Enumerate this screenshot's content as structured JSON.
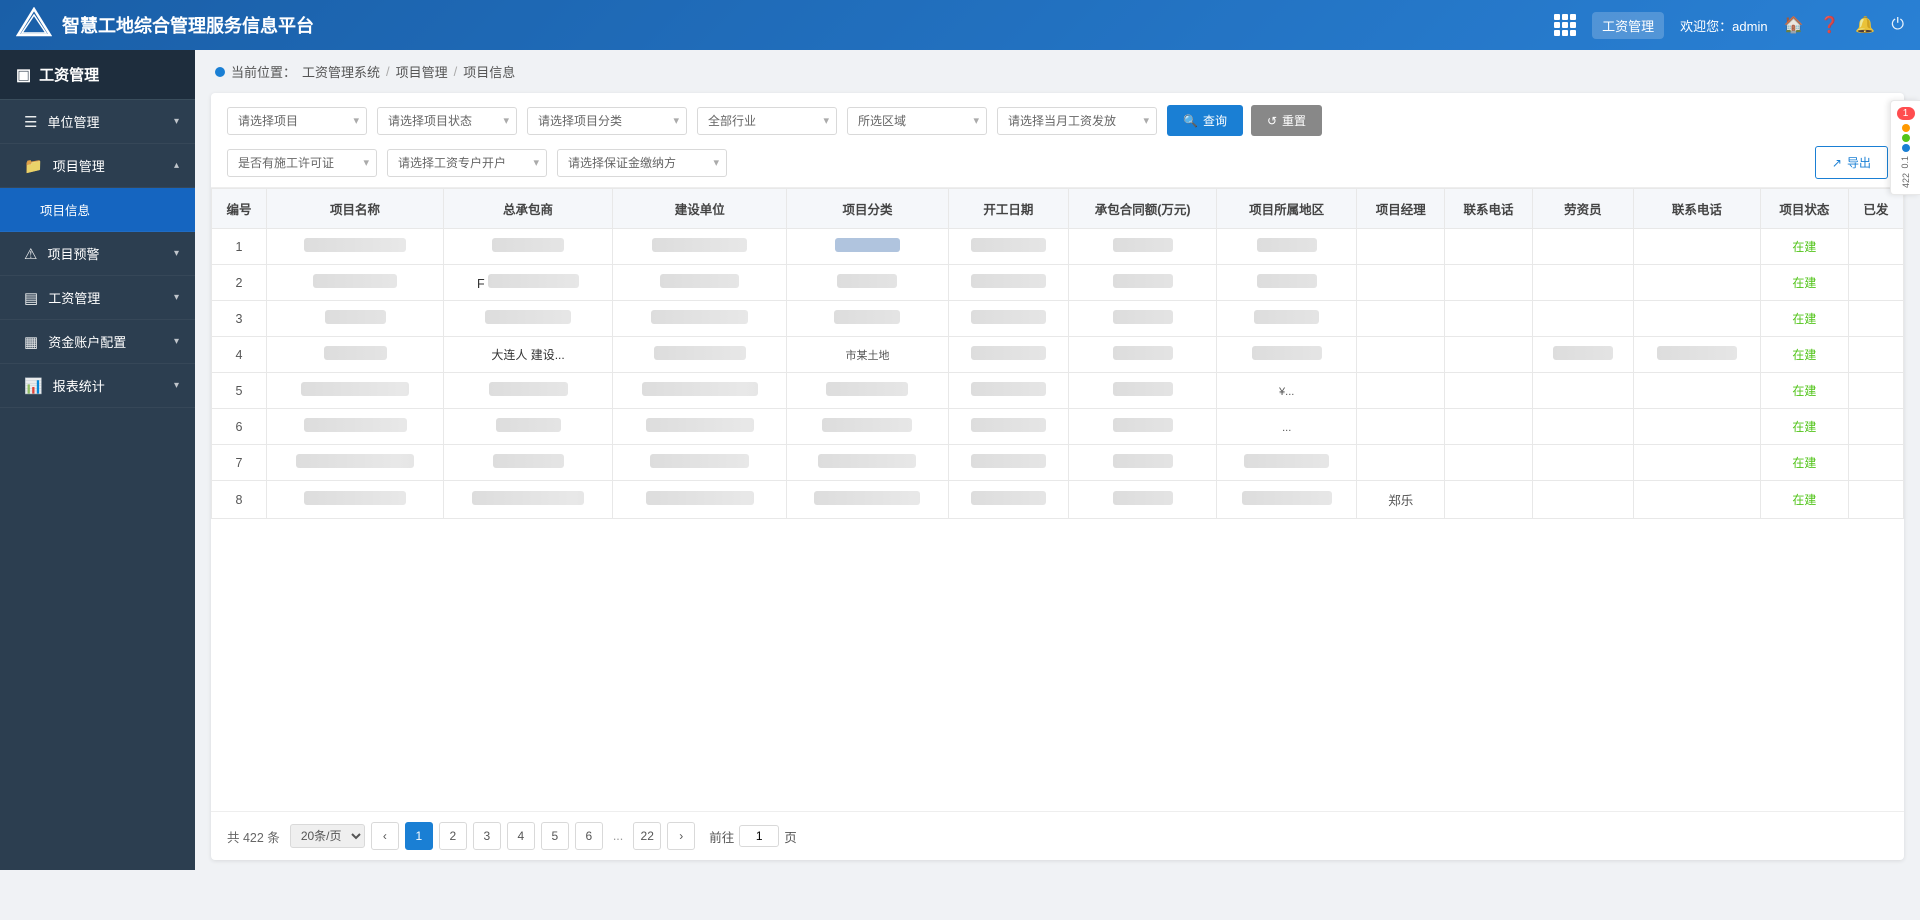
{
  "header": {
    "logo_text": "智慧工地综合管理服务信息平台",
    "apps_label": "工资管理",
    "welcome_text": "欢迎您：admin"
  },
  "sidebar": {
    "header_label": "工资管理",
    "items": [
      {
        "id": "unit-mgmt",
        "label": "单位管理",
        "icon": "☰",
        "has_arrow": true,
        "active": false
      },
      {
        "id": "project-mgmt",
        "label": "项目管理",
        "icon": "📁",
        "has_arrow": true,
        "active": true
      },
      {
        "id": "project-info",
        "label": "项目信息",
        "icon": "",
        "has_arrow": false,
        "active": true,
        "sub": true
      },
      {
        "id": "project-warning",
        "label": "项目预警",
        "icon": "⚠",
        "has_arrow": true,
        "active": false
      },
      {
        "id": "wage-mgmt",
        "label": "工资管理",
        "icon": "💰",
        "has_arrow": true,
        "active": false
      },
      {
        "id": "fund-account",
        "label": "资金账户配置",
        "icon": "🏦",
        "has_arrow": true,
        "active": false
      },
      {
        "id": "report-stats",
        "label": "报表统计",
        "icon": "📊",
        "has_arrow": true,
        "active": false
      }
    ]
  },
  "breadcrumb": {
    "items": [
      "工资管理系统",
      "项目管理",
      "项目信息"
    ]
  },
  "filters": {
    "row1": [
      {
        "id": "project",
        "placeholder": "请选择项目"
      },
      {
        "id": "project-status",
        "placeholder": "请选择项目状态"
      },
      {
        "id": "project-type",
        "placeholder": "请选择项目分类"
      },
      {
        "id": "industry",
        "placeholder": "全部行业"
      },
      {
        "id": "region",
        "placeholder": "所选区域"
      },
      {
        "id": "salary-month",
        "placeholder": "请选择当月工资发放"
      }
    ],
    "row2": [
      {
        "id": "construction-permit",
        "placeholder": "是否有施工许可证"
      },
      {
        "id": "salary-account",
        "placeholder": "请选择工资专户开户"
      },
      {
        "id": "guarantee",
        "placeholder": "请选择保证金缴纳方"
      }
    ],
    "query_btn": "查询",
    "reset_btn": "重置",
    "export_btn": "导出"
  },
  "table": {
    "columns": [
      "编号",
      "项目名称",
      "总承包商",
      "建设单位",
      "项目分类",
      "开工日期",
      "承包合同额(万元)",
      "项目所属地区",
      "项目经理",
      "联系电话",
      "劳资员",
      "联系电话",
      "项目状态",
      "已发"
    ],
    "rows": [
      {
        "id": 1,
        "status": "在建"
      },
      {
        "id": 2,
        "status": "在建"
      },
      {
        "id": 3,
        "status": "在建"
      },
      {
        "id": 4,
        "extra": "大连人  建设...",
        "extra2": "市某土地",
        "status": "在建"
      },
      {
        "id": 5,
        "status": "在建"
      },
      {
        "id": 6,
        "status": "在建"
      },
      {
        "id": 7,
        "status": "在建"
      },
      {
        "id": 8,
        "extra3": "郑乐",
        "status": "在建"
      }
    ]
  },
  "pagination": {
    "total_label": "共 422 条",
    "page_size": "20条/页",
    "pages": [
      "1",
      "2",
      "3",
      "4",
      "5",
      "6",
      "...",
      "22"
    ],
    "current_page": "1",
    "jump_prefix": "前往",
    "jump_suffix": "页",
    "jump_value": "1"
  },
  "right_panel": {
    "badge_count": "1",
    "mini_text": "0.1"
  }
}
